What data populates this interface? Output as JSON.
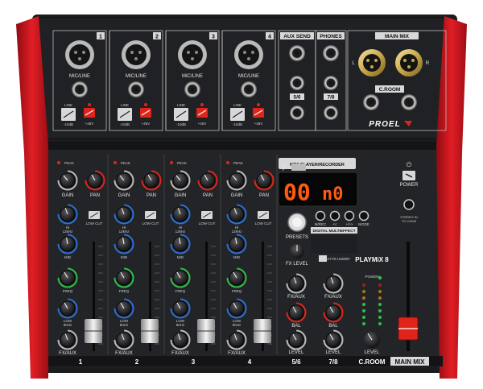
{
  "colors": {
    "body": "#1b1c1e",
    "panel": "#232427",
    "side": "#c8161d",
    "accent_red": "#e0241b",
    "led": "#ff5a10"
  },
  "top_panel": {
    "channel_numbers": [
      "1",
      "2",
      "3",
      "4"
    ],
    "mic_line_label": "MIC/LINE",
    "line_pad_label": "LINE",
    "pad_db_label": "-10dB",
    "phantom_label": "+48V",
    "aux_send_label": "AUX SEND",
    "phones_label": "PHONES",
    "main_mix_label": "MAIN MIX",
    "croom_label": "C.ROOM",
    "stereo_56_label": "5/6",
    "stereo_78_label": "7/8",
    "left_label": "L",
    "right_label": "R",
    "brand": "PROEL"
  },
  "channel_strip": {
    "peak_label": "PEAK",
    "gain_label": "GAIN",
    "pan_label": "PAN",
    "hi_label": "HI",
    "hi_freq": "12kHz",
    "low_cut_label": "LOW CUT",
    "mid_label": "MID",
    "freq_label": "FREQ",
    "low_label": "LOW",
    "low_freq": "80Hz",
    "fx_aux_label": "FX/AUX",
    "footer_labels": [
      "1",
      "2",
      "3",
      "4"
    ]
  },
  "mp3": {
    "title": "MP3 PLAYER/RECORDER",
    "display_left": "00",
    "display_right": "n0",
    "button_labels": [
      "M/REC",
      "<<",
      "+/>>",
      "MODE"
    ],
    "effect_title": "DIGITAL MULTIEFFECT",
    "presets_label": "PRESETS",
    "fx_level_label": "FX LEVEL",
    "usb_label": "CH7/8 USB/BT"
  },
  "master": {
    "power_label": "POWER",
    "stereo_in_label": "STEREO IN TO CH5/6",
    "model": "PLAYMiX 8",
    "led_power_label": "POWER",
    "fx_aux_label": "FX/AUX",
    "bal_label": "BAL",
    "level_label": "LEVEL",
    "footer_56": "5/6",
    "footer_78": "7/8",
    "footer_croom": "C.ROOM",
    "footer_main": "MAIN MIX"
  }
}
